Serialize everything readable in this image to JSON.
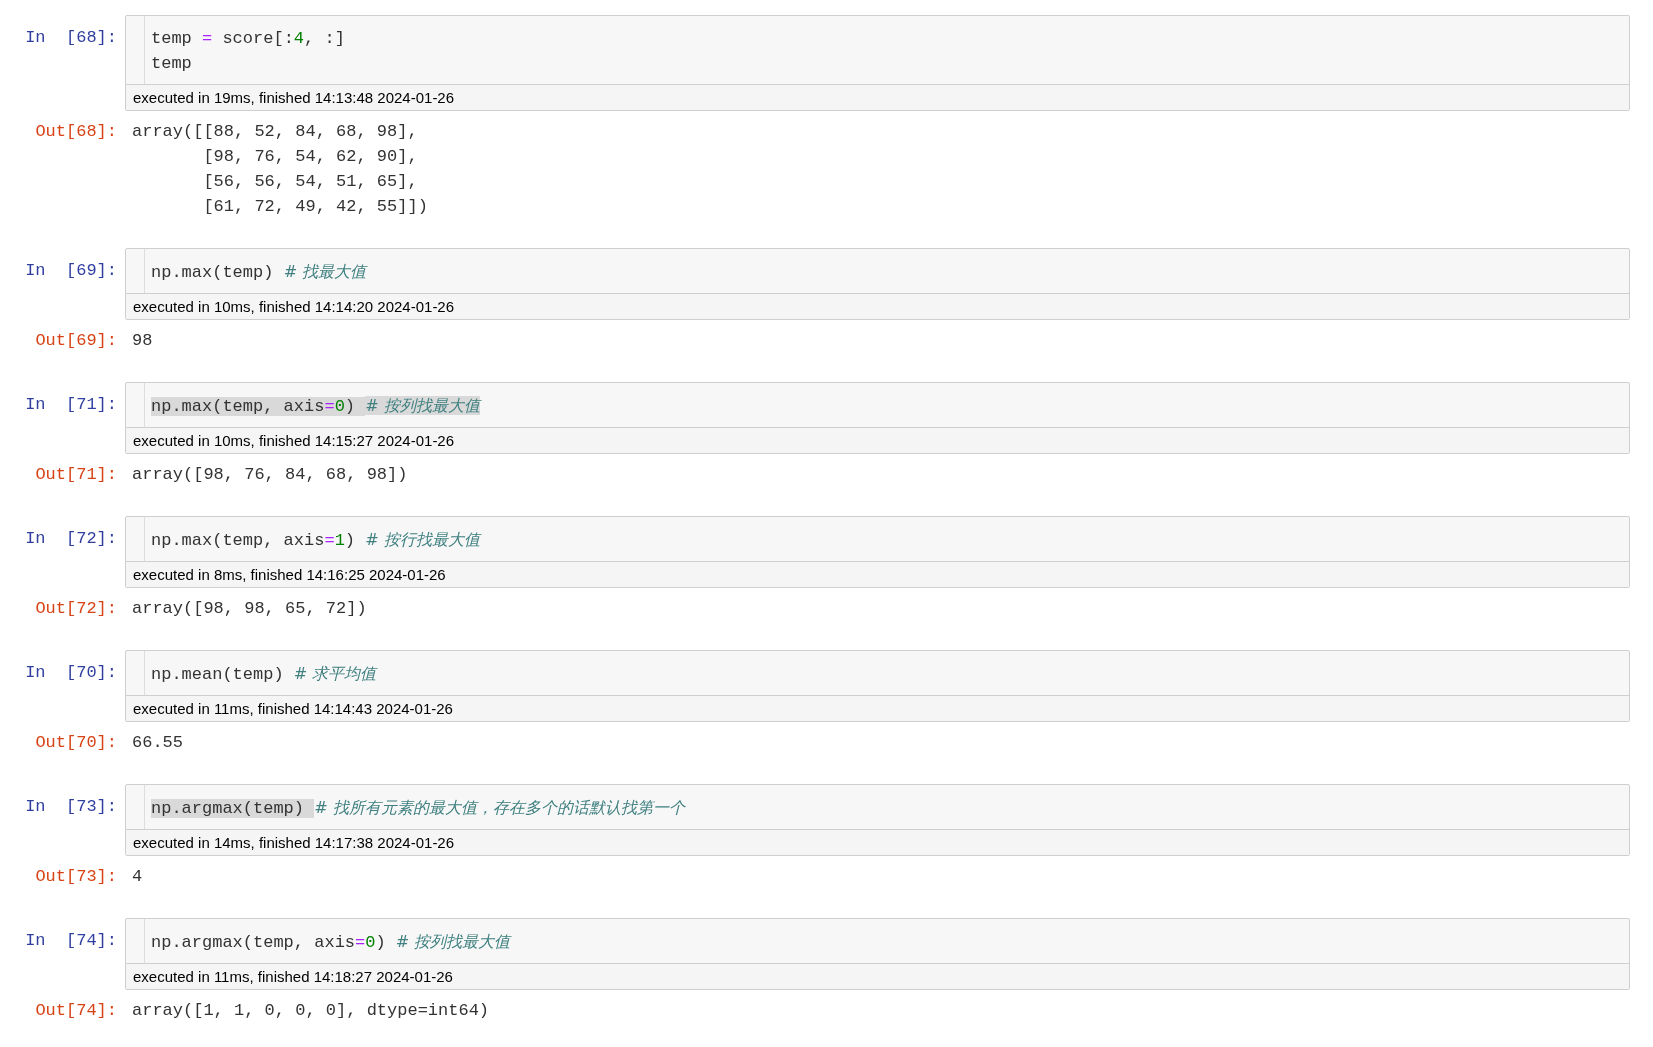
{
  "cells": [
    {
      "prompt_in": "In  [68]:",
      "code": [
        [
          {
            "kind": "text",
            "text": "temp ",
            "selected": false
          },
          {
            "kind": "op",
            "text": "=",
            "selected": false
          },
          {
            "kind": "text",
            "text": " score[:",
            "selected": false
          },
          {
            "kind": "number",
            "text": "4",
            "selected": false
          },
          {
            "kind": "text",
            "text": ", :]",
            "selected": false
          }
        ],
        [
          {
            "kind": "text",
            "text": "temp",
            "selected": false
          }
        ]
      ],
      "executed": "executed in 19ms, finished 14:13:48 2024-01-26",
      "prompt_out": "Out[68]:",
      "output": [
        "array([[88, 52, 84, 68, 98],",
        "       [98, 76, 54, 62, 90],",
        "       [56, 56, 54, 51, 65],",
        "       [61, 72, 49, 42, 55]])"
      ]
    },
    {
      "prompt_in": "In  [69]:",
      "code": [
        [
          {
            "kind": "text",
            "text": "np.max(temp) ",
            "selected": false
          },
          {
            "kind": "comment",
            "text": "# 找最大值",
            "selected": false
          }
        ]
      ],
      "executed": "executed in 10ms, finished 14:14:20 2024-01-26",
      "prompt_out": "Out[69]:",
      "output": [
        "98"
      ]
    },
    {
      "prompt_in": "In  [71]:",
      "code": [
        [
          {
            "kind": "text",
            "text": "np.max(temp, axis",
            "selected": true
          },
          {
            "kind": "op",
            "text": "=",
            "selected": true
          },
          {
            "kind": "number",
            "text": "0",
            "selected": true
          },
          {
            "kind": "text",
            "text": ") ",
            "selected": true
          },
          {
            "kind": "comment",
            "text": "# 按列找最大值",
            "selected": true
          }
        ]
      ],
      "executed": "executed in 10ms, finished 14:15:27 2024-01-26",
      "prompt_out": "Out[71]:",
      "output": [
        "array([98, 76, 84, 68, 98])"
      ]
    },
    {
      "prompt_in": "In  [72]:",
      "code": [
        [
          {
            "kind": "text",
            "text": "np.max(temp, axis",
            "selected": false
          },
          {
            "kind": "op",
            "text": "=",
            "selected": false
          },
          {
            "kind": "number",
            "text": "1",
            "selected": false
          },
          {
            "kind": "text",
            "text": ") ",
            "selected": false
          },
          {
            "kind": "comment",
            "text": "# 按行找最大值",
            "selected": false
          }
        ]
      ],
      "executed": "executed in 8ms, finished 14:16:25 2024-01-26",
      "prompt_out": "Out[72]:",
      "output": [
        "array([98, 98, 65, 72])"
      ]
    },
    {
      "prompt_in": "In  [70]:",
      "code": [
        [
          {
            "kind": "text",
            "text": "np.mean(temp) ",
            "selected": false
          },
          {
            "kind": "comment",
            "text": "# 求平均值",
            "selected": false
          }
        ]
      ],
      "executed": "executed in 11ms, finished 14:14:43 2024-01-26",
      "prompt_out": "Out[70]:",
      "output": [
        "66.55"
      ]
    },
    {
      "prompt_in": "In  [73]:",
      "code": [
        [
          {
            "kind": "text",
            "text": "np.argmax(temp) ",
            "selected": true
          },
          {
            "kind": "comment",
            "text": "# 找所有元素的最大值，存在多个的话默认找第一个",
            "selected": false
          }
        ]
      ],
      "executed": "executed in 14ms, finished 14:17:38 2024-01-26",
      "prompt_out": "Out[73]:",
      "output": [
        "4"
      ]
    },
    {
      "prompt_in": "In  [74]:",
      "code": [
        [
          {
            "kind": "text",
            "text": "np.argmax(temp, axis",
            "selected": false
          },
          {
            "kind": "op",
            "text": "=",
            "selected": false
          },
          {
            "kind": "number",
            "text": "0",
            "selected": false
          },
          {
            "kind": "text",
            "text": ") ",
            "selected": false
          },
          {
            "kind": "comment",
            "text": "# 按列找最大值",
            "selected": false
          }
        ]
      ],
      "executed": "executed in 11ms, finished 14:18:27 2024-01-26",
      "prompt_out": "Out[74]:",
      "output": [
        "array([1, 1, 0, 0, 0], dtype=int64)"
      ]
    }
  ]
}
